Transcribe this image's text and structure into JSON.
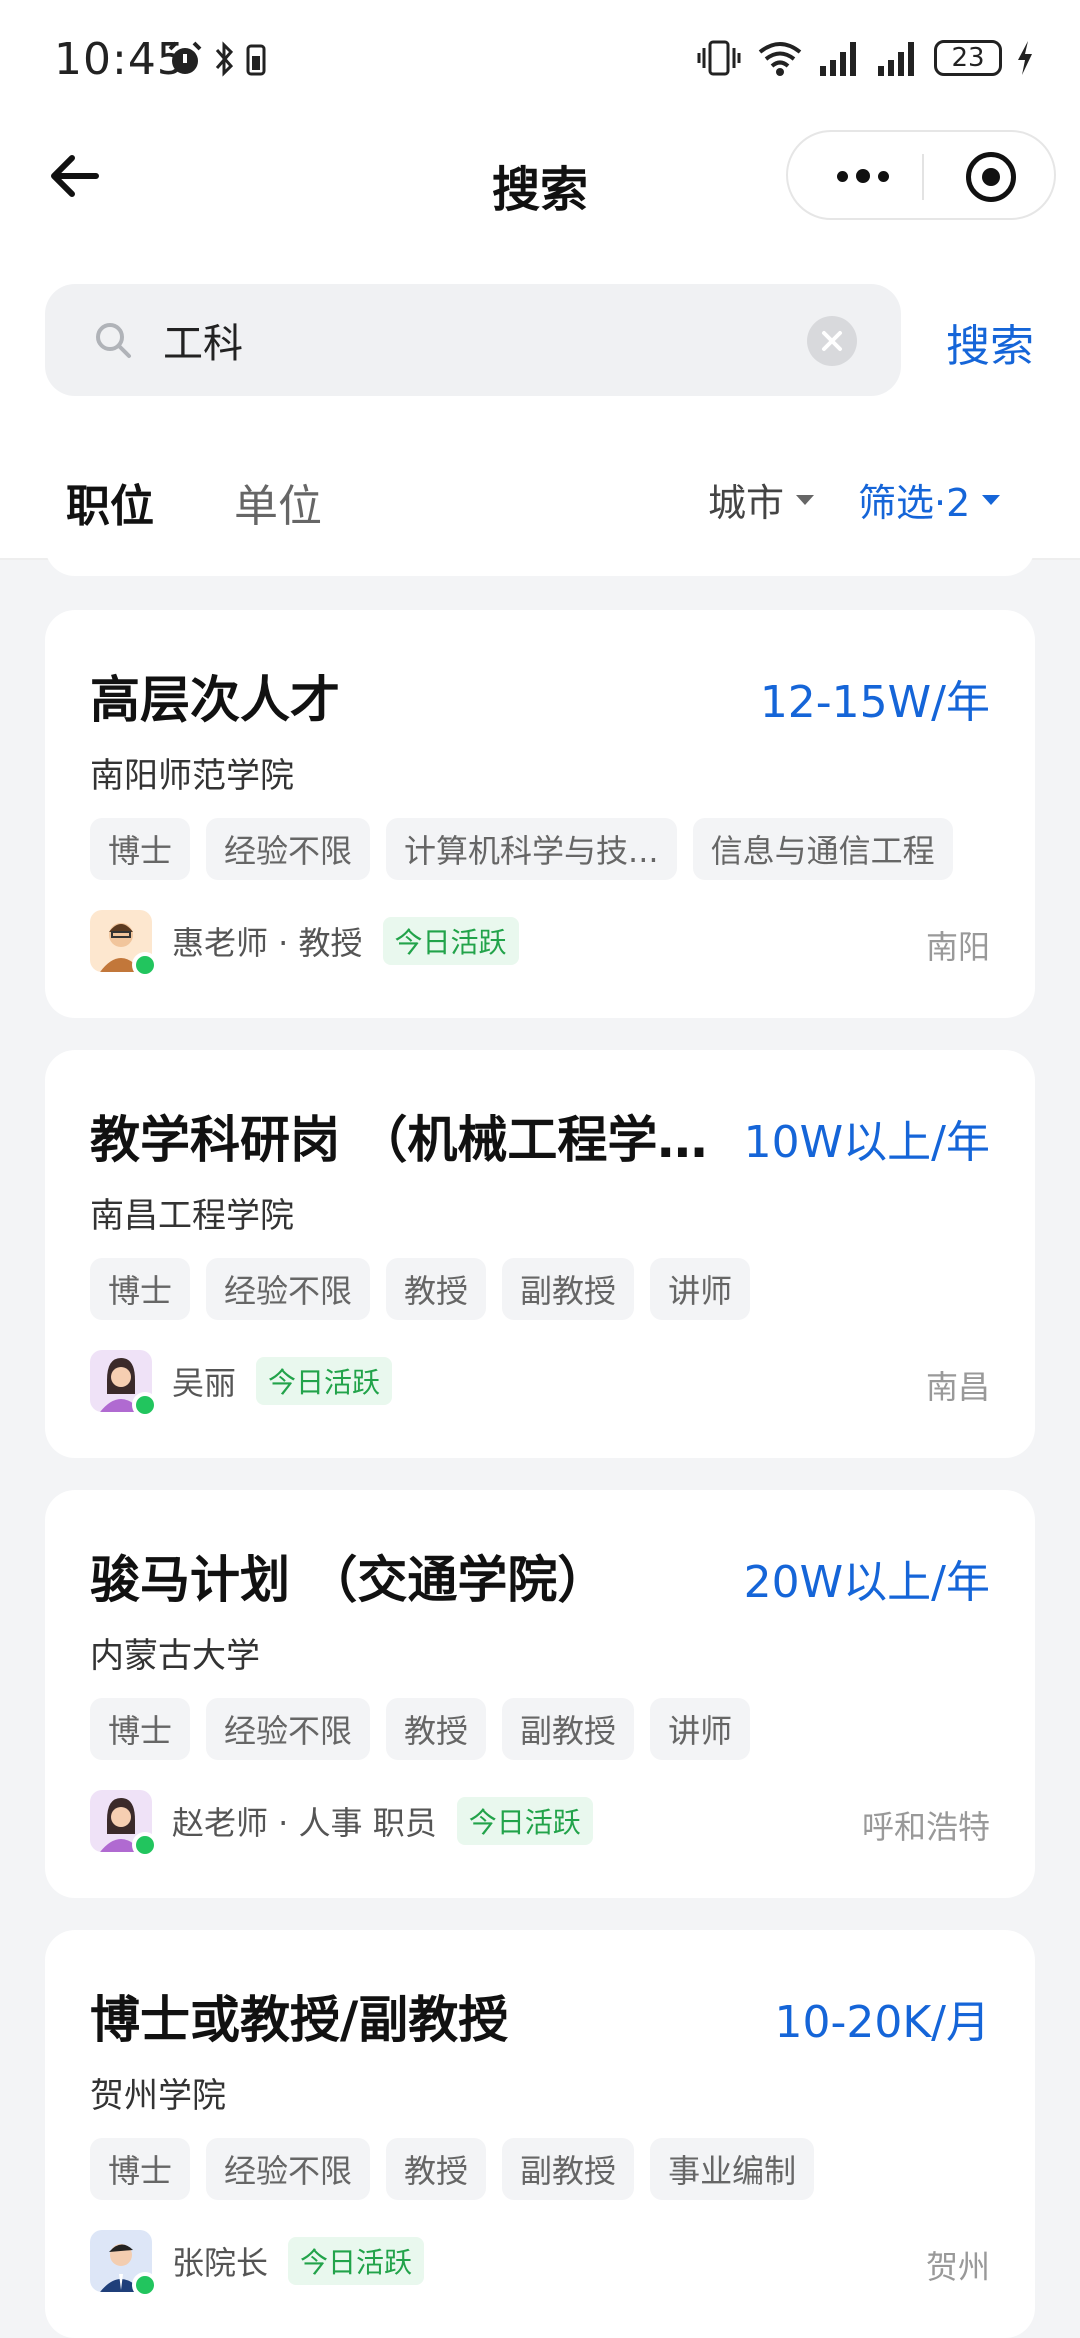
{
  "status_bar": {
    "time": "10:45",
    "battery": "23"
  },
  "nav": {
    "title": "搜索"
  },
  "search": {
    "value": "工科",
    "placeholder": "",
    "button_label": "搜索"
  },
  "tabs": [
    {
      "label": "职位",
      "active": true
    },
    {
      "label": "单位",
      "active": false
    }
  ],
  "filters": {
    "city_label": "城市",
    "filter_label": "筛选·2"
  },
  "colors": {
    "accent": "#1565d8",
    "active_green": "#22a34a"
  },
  "jobs": [
    {
      "title": "高层次人才",
      "salary": "12-15W/年",
      "company": "南阳师范学院",
      "tags": [
        "博士",
        "经验不限",
        "计算机科学与技...",
        "信息与通信工程"
      ],
      "recruiter": "惠老师 · 教授",
      "activity": "今日活跃",
      "city": "南阳"
    },
    {
      "title": "教学科研岗 （机械工程学…",
      "salary": "10W以上/年",
      "company": "南昌工程学院",
      "tags": [
        "博士",
        "经验不限",
        "教授",
        "副教授",
        "讲师"
      ],
      "recruiter": "吴丽",
      "activity": "今日活跃",
      "city": "南昌"
    },
    {
      "title": "骏马计划 （交通学院）",
      "salary": "20W以上/年",
      "company": "内蒙古大学",
      "tags": [
        "博士",
        "经验不限",
        "教授",
        "副教授",
        "讲师"
      ],
      "recruiter": "赵老师 · 人事 职员",
      "activity": "今日活跃",
      "city": "呼和浩特"
    },
    {
      "title": "博士或教授/副教授",
      "salary": "10-20K/月",
      "company": "贺州学院",
      "tags": [
        "博士",
        "经验不限",
        "教授",
        "副教授",
        "事业编制"
      ],
      "recruiter": "张院长",
      "activity": "今日活跃",
      "city": "贺州"
    }
  ]
}
